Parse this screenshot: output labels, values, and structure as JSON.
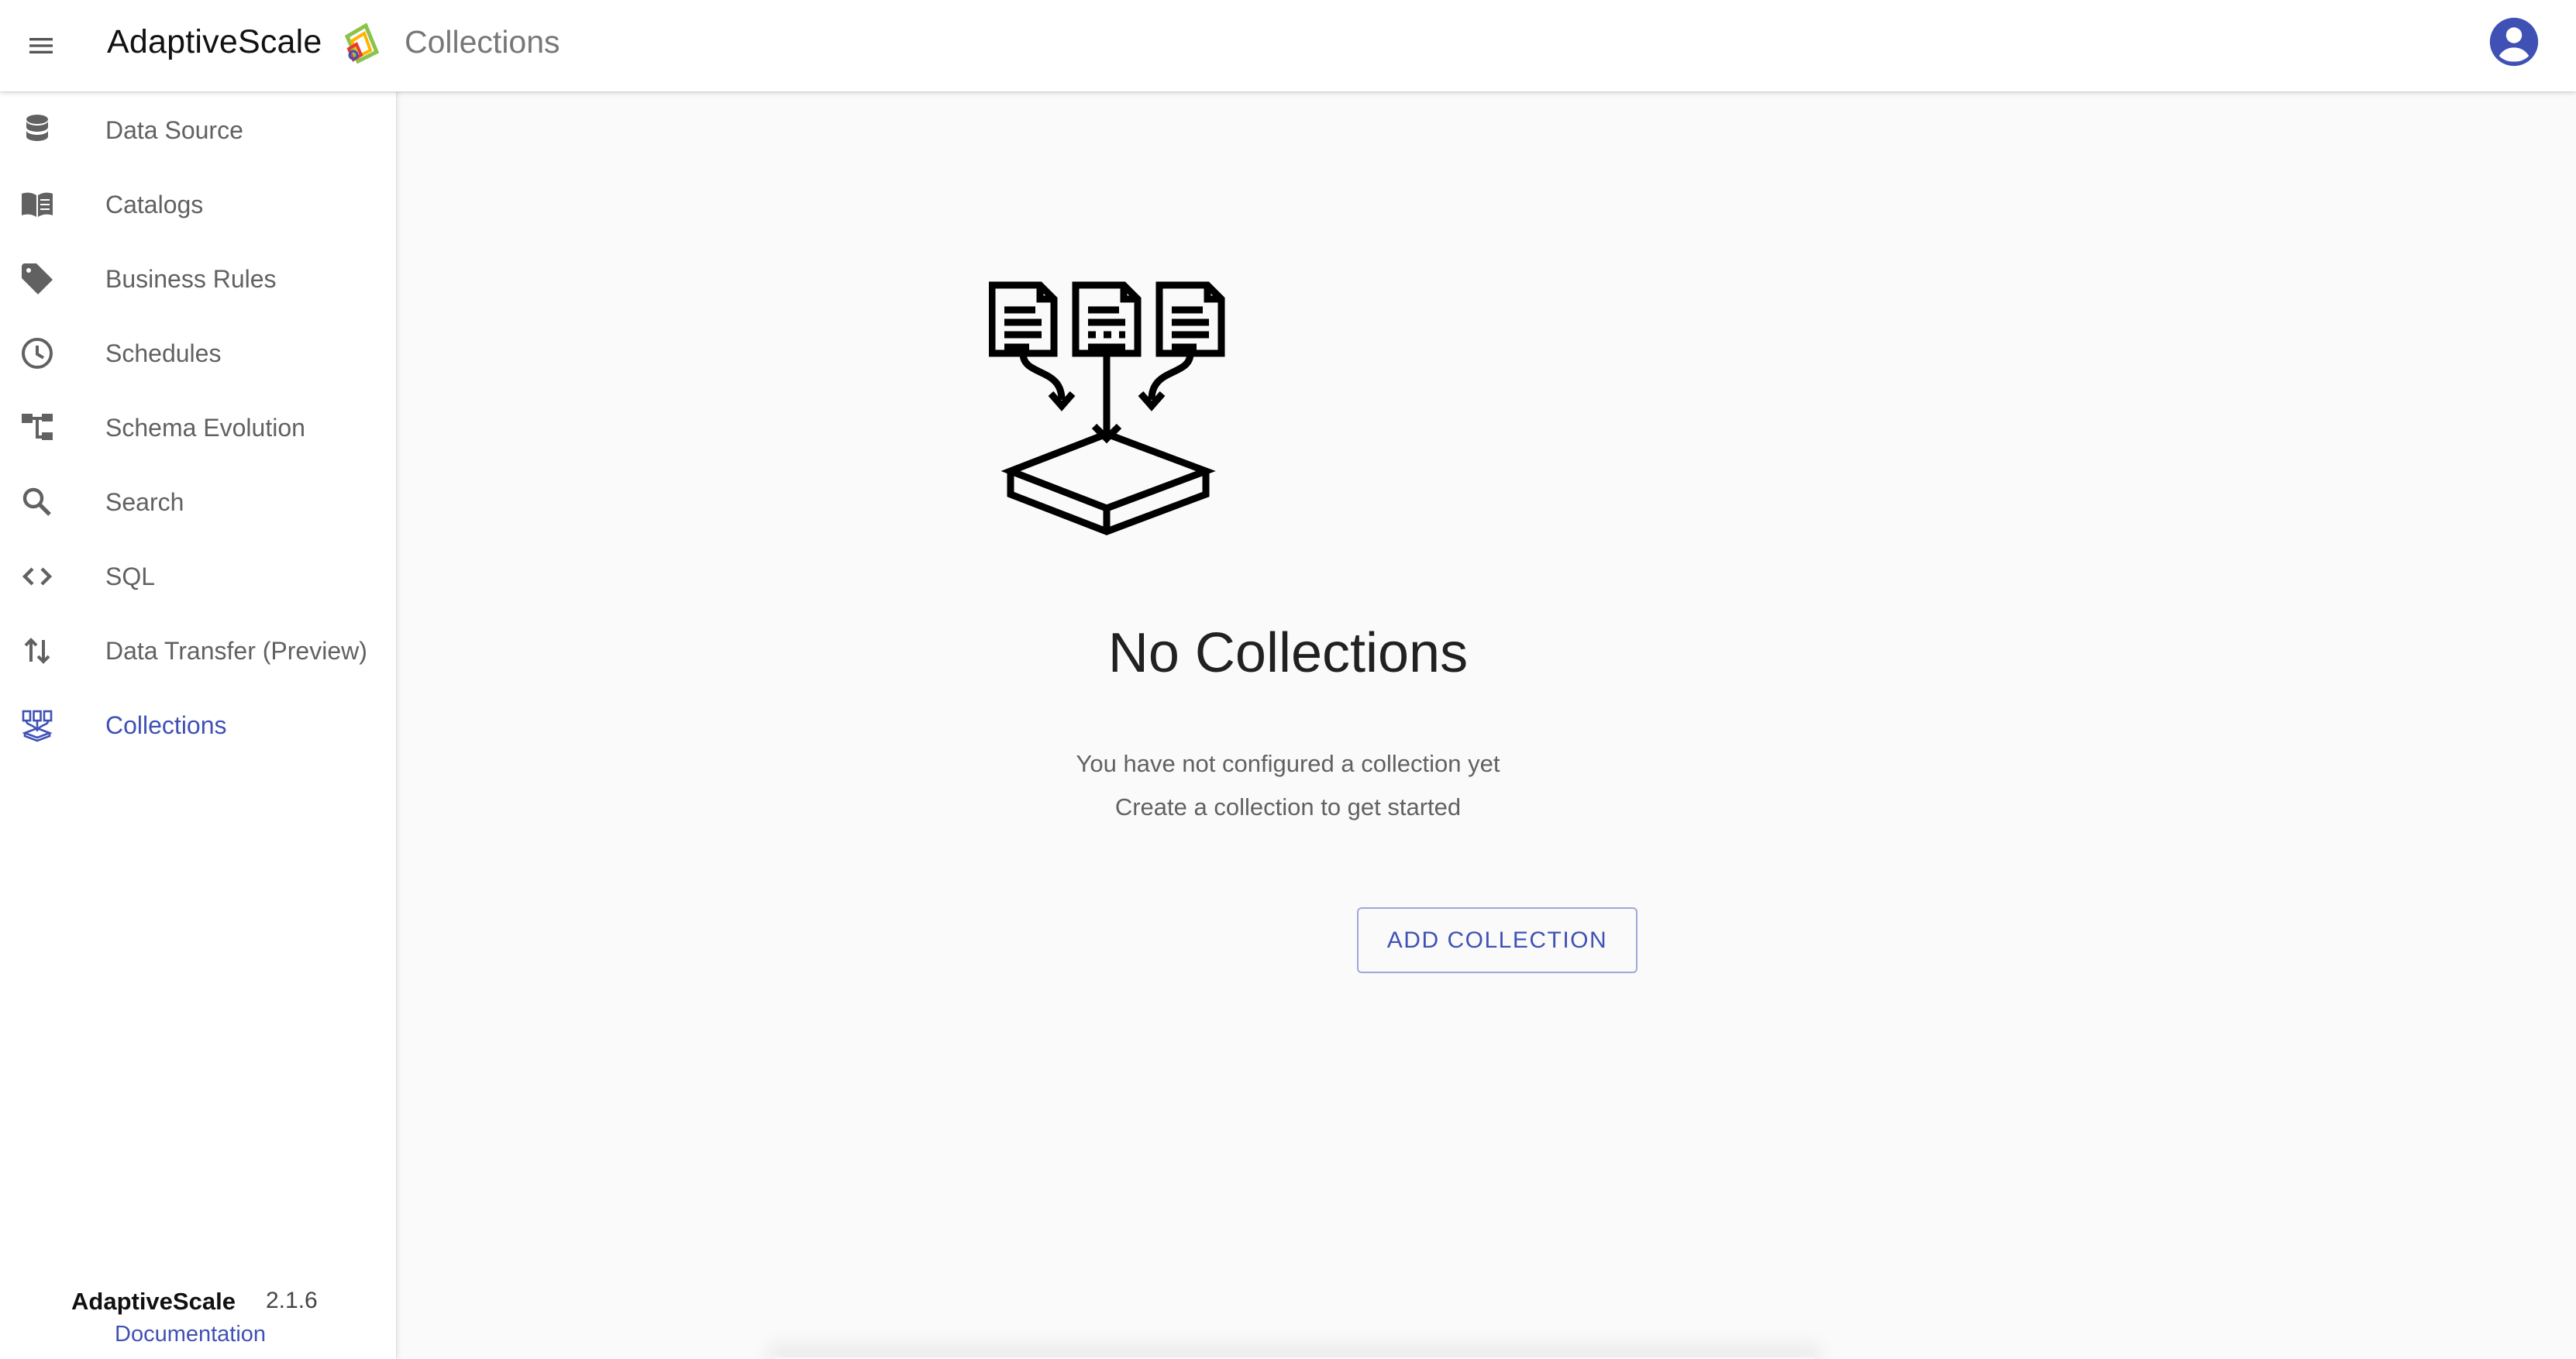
{
  "header": {
    "brand": "AdaptiveScale",
    "page_title": "Collections"
  },
  "sidebar": {
    "items": [
      {
        "label": "Data Source",
        "icon": "database-icon",
        "active": false
      },
      {
        "label": "Catalogs",
        "icon": "book-icon",
        "active": false
      },
      {
        "label": "Business Rules",
        "icon": "tag-icon",
        "active": false
      },
      {
        "label": "Schedules",
        "icon": "clock-icon",
        "active": false
      },
      {
        "label": "Schema Evolution",
        "icon": "tree-icon",
        "active": false
      },
      {
        "label": "Search",
        "icon": "search-icon",
        "active": false
      },
      {
        "label": "SQL",
        "icon": "code-icon",
        "active": false
      },
      {
        "label": "Data Transfer (Preview)",
        "icon": "transfer-arrows-icon",
        "active": false
      },
      {
        "label": "Collections",
        "icon": "collections-icon",
        "active": true
      }
    ],
    "footer": {
      "brand": "AdaptiveScale",
      "version": "2.1.6",
      "docs_link": "Documentation"
    }
  },
  "main": {
    "empty_state": {
      "icon": "documents-into-box-icon",
      "title": "No Collections",
      "line1": "You have not configured a collection yet",
      "line2": "Create a collection to get started",
      "button_label": "ADD COLLECTION"
    }
  },
  "colors": {
    "accent": "#3f51b5",
    "text_muted": "#616161",
    "background": "#fafafa"
  }
}
